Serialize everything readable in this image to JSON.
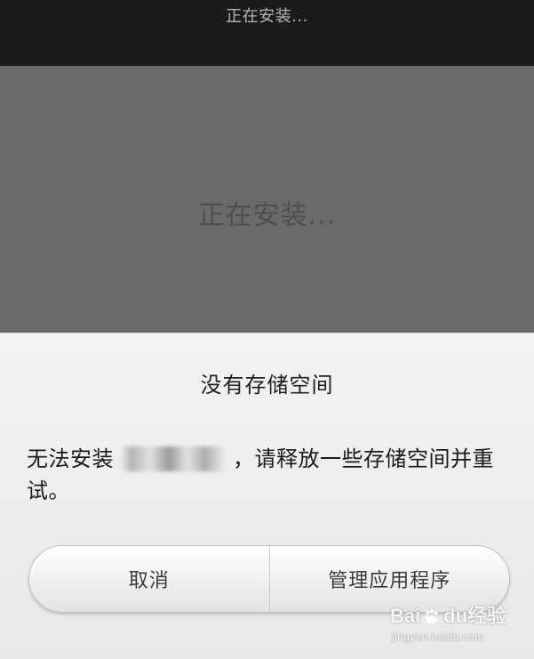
{
  "topbar": {
    "title": "正在安装..."
  },
  "installing": {
    "label": "正在安装..."
  },
  "dialog": {
    "title": "没有存储空间",
    "message_prefix": "无法安装",
    "message_suffix": "，请释放一些存储空间并重试。",
    "buttons": {
      "cancel": "取消",
      "manage_apps": "管理应用程序"
    }
  },
  "watermark": {
    "brand_left": "Bai",
    "brand_mid": "du",
    "brand_right": "经验",
    "site": "jingyan.baidu.com"
  },
  "icons": {
    "paw": "paw-icon"
  }
}
